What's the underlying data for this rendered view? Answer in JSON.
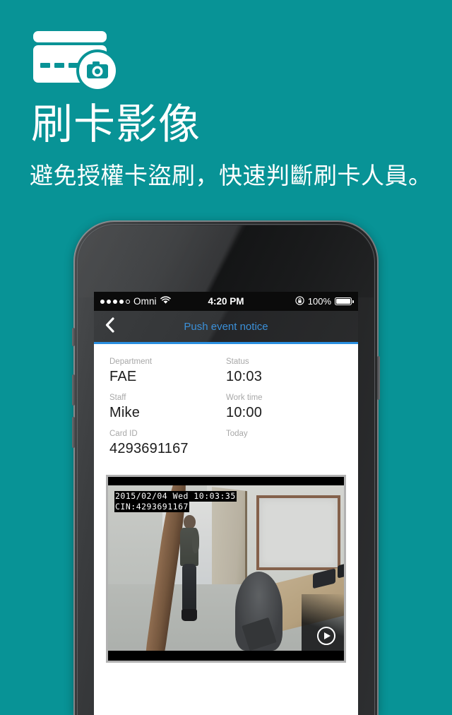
{
  "hero": {
    "icon_name": "card-camera-icon",
    "title": "刷卡影像",
    "subtitle": "避免授權卡盜刷，快速判斷刷卡人員。",
    "background_color": "#089396",
    "text_color": "#ffffff"
  },
  "phone": {
    "statusbar": {
      "signal_dots_filled": 4,
      "signal_dots_total": 5,
      "carrier": "Omni",
      "wifi_icon": "wifi-icon",
      "time": "4:20 PM",
      "rotation_lock_icon": "rotation-lock-icon",
      "battery_percent": "100%",
      "battery_level": 100
    },
    "navbar": {
      "back_icon": "chevron-left-icon",
      "title": "Push event notice",
      "title_color": "#3b90d8",
      "underline_color": "#2a8fe0"
    },
    "details": [
      {
        "label": "Department",
        "value": "FAE"
      },
      {
        "label": "Status",
        "value": "10:03"
      },
      {
        "label": "Staff",
        "value": "Mike"
      },
      {
        "label": "Work time",
        "value": "10:00"
      },
      {
        "label": "Card ID",
        "value": "4293691167"
      },
      {
        "label": "Today",
        "value": ""
      }
    ],
    "video": {
      "osd_line1": "2015/02/04 Wed 10:03:35",
      "osd_line2": "CIN:4293691167",
      "play_icon": "play-icon",
      "border_color": "#b2b2b2"
    }
  }
}
